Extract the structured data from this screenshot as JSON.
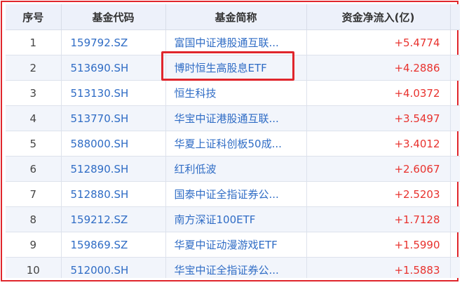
{
  "columns": [
    "序号",
    "基金代码",
    "基金简称",
    "资金净流入(亿)"
  ],
  "rows": [
    {
      "idx": "1",
      "code": "159792.SZ",
      "name": "富国中证港股通互联...",
      "flow": "+5.4774"
    },
    {
      "idx": "2",
      "code": "513690.SH",
      "name": "博时恒生高股息ETF",
      "flow": "+4.2886"
    },
    {
      "idx": "3",
      "code": "513130.SH",
      "name": "恒生科技",
      "flow": "+4.0372"
    },
    {
      "idx": "4",
      "code": "513770.SH",
      "name": "华宝中证港股通互联...",
      "flow": "+3.5497"
    },
    {
      "idx": "5",
      "code": "588000.SH",
      "name": "华夏上证科创板50成...",
      "flow": "+3.4012"
    },
    {
      "idx": "6",
      "code": "512890.SH",
      "name": "红利低波",
      "flow": "+2.6067"
    },
    {
      "idx": "7",
      "code": "512880.SH",
      "name": "国泰中证全指证券公...",
      "flow": "+2.5203"
    },
    {
      "idx": "8",
      "code": "159212.SZ",
      "name": "南方深证100ETF",
      "flow": "+1.7128"
    },
    {
      "idx": "9",
      "code": "159869.SZ",
      "name": "华夏中证动漫游戏ETF",
      "flow": "+1.5990"
    },
    {
      "idx": "10",
      "code": "512000.SH",
      "name": "华宝中证全指证券公...",
      "flow": "+1.5883"
    }
  ],
  "highlight_row": 2,
  "colors": {
    "accent_red": "#e0262c",
    "link_blue": "#2f6cc5",
    "positive": "#e8322e",
    "header_bg": "#edf1fa"
  }
}
